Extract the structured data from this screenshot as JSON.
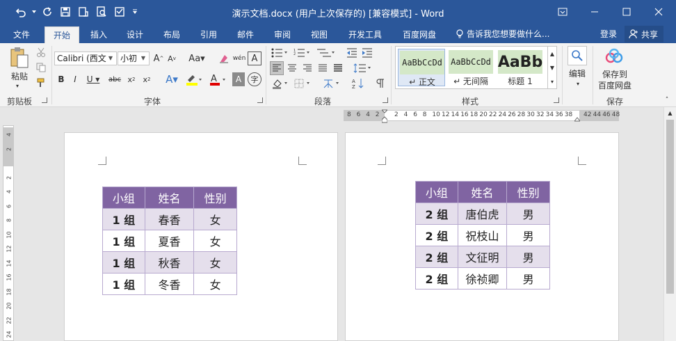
{
  "window": {
    "title": "演示文档.docx (用户上次保存的) [兼容模式] - Word"
  },
  "tabs": [
    {
      "label": "文件",
      "active": false
    },
    {
      "label": "开始",
      "active": true
    },
    {
      "label": "插入",
      "active": false
    },
    {
      "label": "设计",
      "active": false
    },
    {
      "label": "布局",
      "active": false
    },
    {
      "label": "引用",
      "active": false
    },
    {
      "label": "邮件",
      "active": false
    },
    {
      "label": "审阅",
      "active": false
    },
    {
      "label": "视图",
      "active": false
    },
    {
      "label": "开发工具",
      "active": false
    },
    {
      "label": "百度网盘",
      "active": false
    }
  ],
  "tellme": "告诉我您想要做什么...",
  "account": {
    "login": "登录",
    "share": "共享"
  },
  "ribbon": {
    "clipboard": {
      "paste": "粘贴",
      "group": "剪贴板"
    },
    "font": {
      "name": "Calibri (西文正文)",
      "name_display": "Calibri (西文",
      "size": "小初",
      "group": "字体"
    },
    "paragraph": {
      "group": "段落"
    },
    "styles": {
      "group": "样式",
      "items": [
        {
          "preview": "AaBbCcDd",
          "name": "↵ 正文"
        },
        {
          "preview": "AaBbCcDd",
          "name": "↵ 无间隔"
        },
        {
          "preview": "AaBb",
          "name": "标题 1"
        }
      ]
    },
    "editing": {
      "label": "编辑"
    },
    "save": {
      "label1": "保存到",
      "label2": "百度网盘",
      "group": "保存"
    }
  },
  "ruler": {
    "h_numbers": [
      "8",
      "6",
      "4",
      "2",
      "",
      "2",
      "4",
      "6",
      "8",
      "10",
      "12",
      "14",
      "16",
      "18",
      "20",
      "22",
      "24",
      "26",
      "28",
      "30",
      "32",
      "34",
      "36",
      "38",
      "",
      "42",
      "44",
      "46",
      "48"
    ],
    "v_numbers": [
      "4",
      "2",
      "",
      "2",
      "4",
      "6",
      "8",
      "10",
      "12",
      "14",
      "16",
      "18",
      "20",
      "22",
      "24"
    ]
  },
  "colors": {
    "title_bar": "#2b579a",
    "table_header": "#8064a2",
    "table_band": "#e5dfec",
    "table_border": "#b7a9cf"
  },
  "tables": {
    "left": {
      "headers": [
        "小组",
        "姓名",
        "性别"
      ],
      "rows": [
        [
          "1 组",
          "春香",
          "女"
        ],
        [
          "1 组",
          "夏香",
          "女"
        ],
        [
          "1 组",
          "秋香",
          "女"
        ],
        [
          "1 组",
          "冬香",
          "女"
        ]
      ]
    },
    "right": {
      "headers": [
        "小组",
        "姓名",
        "性别"
      ],
      "rows": [
        [
          "2 组",
          "唐伯虎",
          "男"
        ],
        [
          "2 组",
          "祝枝山",
          "男"
        ],
        [
          "2 组",
          "文征明",
          "男"
        ],
        [
          "2 组",
          "徐祯卿",
          "男"
        ]
      ]
    }
  }
}
